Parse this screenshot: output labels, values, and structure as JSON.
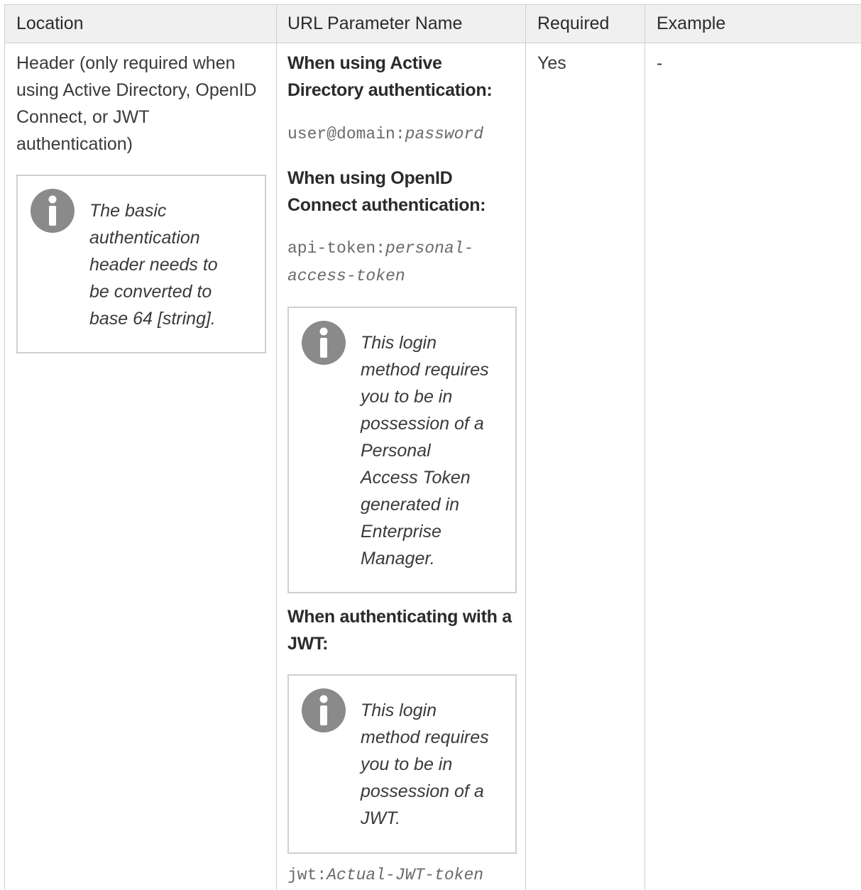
{
  "table": {
    "headers": {
      "location": "Location",
      "url_parameter_name": "URL Parameter Name",
      "required": "Required",
      "example": "Example"
    },
    "row": {
      "location": {
        "text_lines": [
          "Header (only required when",
          "using Active Directory, OpenID",
          "Connect, or JWT",
          "authentication)"
        ],
        "note_lines": [
          "The basic",
          "authentication",
          "header needs to",
          "be converted to",
          "base 64 [string]."
        ]
      },
      "url_parameter": {
        "ad_heading_lines": [
          "When using Active",
          "Directory authentication:"
        ],
        "ad_value_prefix": "user@domain:",
        "ad_value_italic": "password",
        "openid_heading_lines": [
          "When using OpenID",
          "Connect authentication:"
        ],
        "openid_value_prefix": "api-token:",
        "openid_value_italic_line1": "personal-",
        "openid_value_italic_line2": "access-token",
        "openid_note_lines": [
          "This login",
          "method requires",
          "you to be in",
          "possession of a",
          "Personal",
          "Access Token",
          "generated in",
          "Enterprise",
          "Manager."
        ],
        "jwt_heading_lines": [
          "When authenticating with a",
          "JWT:"
        ],
        "jwt_note_lines": [
          "This login",
          "method requires",
          "you to be in",
          "possession of a",
          "JWT."
        ],
        "jwt_value_prefix": "jwt:",
        "jwt_value_italic": "Actual-JWT-token"
      },
      "required": "Yes",
      "example": "-"
    }
  },
  "icons": {
    "note_icon": "info-icon",
    "icon_color": "#8a8a8a"
  },
  "colors": {
    "header_bg": "#f0f0f0",
    "border": "#cfcfcf",
    "text": "#333333",
    "mono_text": "#6a6a6a"
  }
}
